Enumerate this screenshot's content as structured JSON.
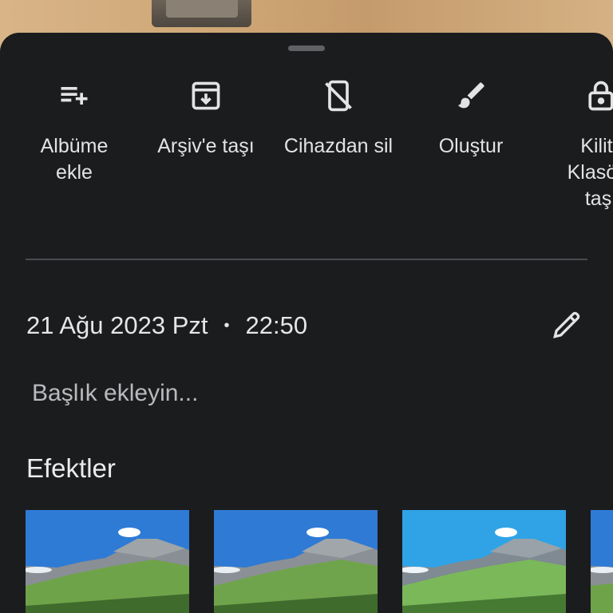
{
  "actions": [
    {
      "label": "Albüme\nekle",
      "icon": "playlist-add-icon"
    },
    {
      "label": "Arşiv'e taşı",
      "icon": "archive-icon"
    },
    {
      "label": "Cihazdan sil",
      "icon": "mobile-off-icon"
    },
    {
      "label": "Oluştur",
      "icon": "brush-icon"
    },
    {
      "label": "Kilitli\nKlasöre\ntaşı",
      "icon": "lock-icon"
    }
  ],
  "details": {
    "date": "21 Ağu 2023 Pzt",
    "separator": "•",
    "time": "22:50",
    "caption_placeholder": "Başlık ekleyin..."
  },
  "effects": {
    "title": "Efektler",
    "thumbnail_count": 4
  },
  "colors": {
    "sheet_bg": "#1b1c1e",
    "text": "#e3e3e6",
    "divider": "#4a4b4f"
  }
}
